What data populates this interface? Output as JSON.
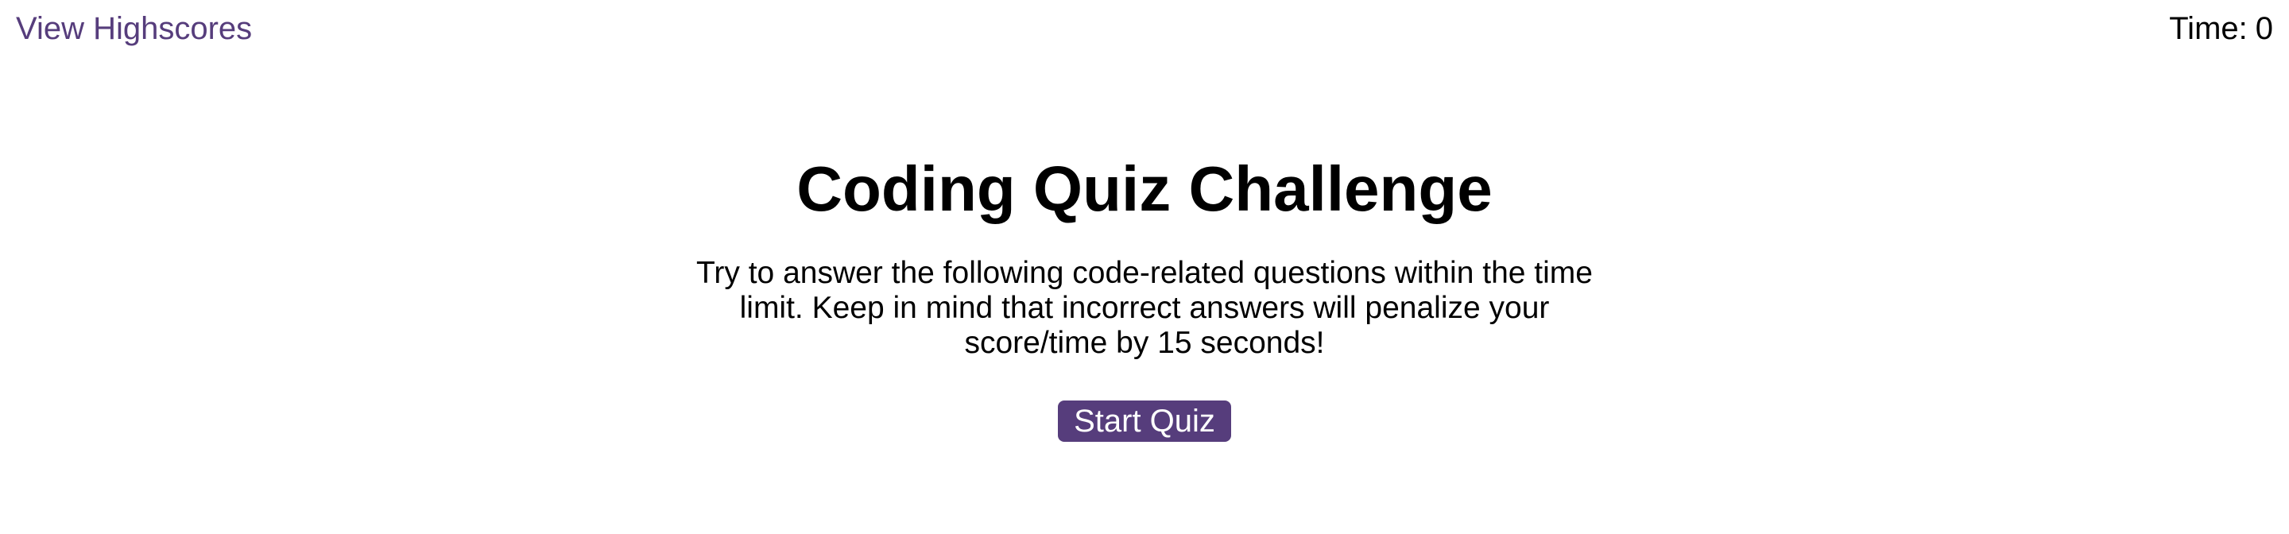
{
  "header": {
    "highscores_link": "View Highscores",
    "timer_label": "Time:",
    "timer_value": "0"
  },
  "main": {
    "title": "Coding Quiz Challenge",
    "description": "Try to answer the following code-related questions within the time limit. Keep in mind that incorrect answers will penalize your score/time by 15 seconds!",
    "start_button": "Start Quiz"
  },
  "colors": {
    "accent": "#563d7c",
    "text": "#000000",
    "background": "#ffffff"
  }
}
